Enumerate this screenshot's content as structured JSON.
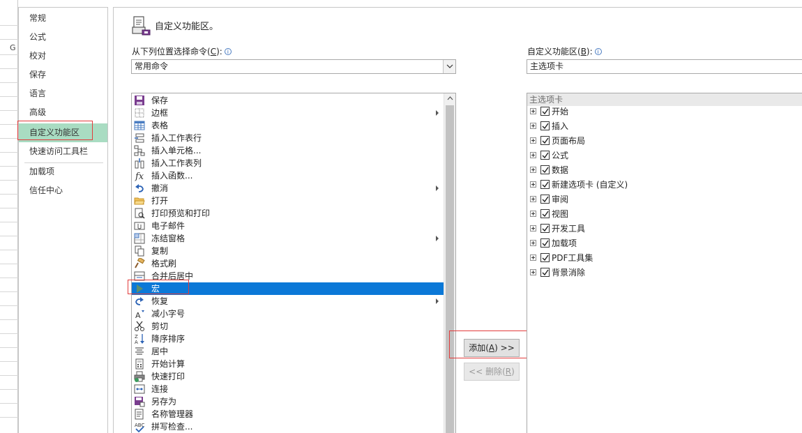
{
  "spreadsheet": {
    "column_letter": "G"
  },
  "nav": {
    "items": [
      {
        "label": "常规",
        "active": false
      },
      {
        "label": "公式",
        "active": false
      },
      {
        "label": "校对",
        "active": false
      },
      {
        "label": "保存",
        "active": false
      },
      {
        "label": "语言",
        "active": false
      },
      {
        "label": "高级",
        "active": false
      },
      {
        "label": "自定义功能区",
        "active": true
      },
      {
        "label": "快速访问工具栏",
        "active": false
      },
      {
        "label": "加载项",
        "active": false
      },
      {
        "label": "信任中心",
        "active": false
      }
    ]
  },
  "header": {
    "title": "自定义功能区。",
    "icon": "customize-ribbon-icon"
  },
  "left_panel": {
    "label": "从下列位置选择命令(C):",
    "label_text": "从下列位置选择命令(",
    "label_key": "C",
    "label_end": "):",
    "combo_value": "常用命令",
    "commands": [
      {
        "label": "保存",
        "icon": "save-icon",
        "submenu": false
      },
      {
        "label": "边框",
        "icon": "borders-icon",
        "submenu": true
      },
      {
        "label": "表格",
        "icon": "table-icon",
        "submenu": false
      },
      {
        "label": "插入工作表行",
        "icon": "insert-row-icon",
        "submenu": false
      },
      {
        "label": "插入单元格...",
        "icon": "insert-cells-icon",
        "submenu": false
      },
      {
        "label": "插入工作表列",
        "icon": "insert-column-icon",
        "submenu": false
      },
      {
        "label": "插入函数...",
        "icon": "function-icon",
        "submenu": false
      },
      {
        "label": "撤消",
        "icon": "undo-icon",
        "submenu": true
      },
      {
        "label": "打开",
        "icon": "open-folder-icon",
        "submenu": false
      },
      {
        "label": "打印预览和打印",
        "icon": "print-preview-icon",
        "submenu": false
      },
      {
        "label": "电子邮件",
        "icon": "email-attach-icon",
        "submenu": false
      },
      {
        "label": "冻结窗格",
        "icon": "freeze-panes-icon",
        "submenu": true
      },
      {
        "label": "复制",
        "icon": "copy-icon",
        "submenu": false
      },
      {
        "label": "格式刷",
        "icon": "format-painter-icon",
        "submenu": false
      },
      {
        "label": "合并后居中",
        "icon": "merge-center-icon",
        "submenu": false
      },
      {
        "label": "宏",
        "icon": "macro-play-icon",
        "submenu": false,
        "selected": true
      },
      {
        "label": "恢复",
        "icon": "redo-icon",
        "submenu": true
      },
      {
        "label": "减小字号",
        "icon": "decrease-font-icon",
        "submenu": false
      },
      {
        "label": "剪切",
        "icon": "scissors-icon",
        "submenu": false
      },
      {
        "label": "降序排序",
        "icon": "sort-descending-icon",
        "submenu": false
      },
      {
        "label": "居中",
        "icon": "align-center-icon",
        "submenu": false
      },
      {
        "label": "开始计算",
        "icon": "calculator-icon",
        "submenu": false
      },
      {
        "label": "快速打印",
        "icon": "quick-print-icon",
        "submenu": false
      },
      {
        "label": "连接",
        "icon": "connections-icon",
        "submenu": false
      },
      {
        "label": "另存为",
        "icon": "save-as-icon",
        "submenu": false
      },
      {
        "label": "名称管理器",
        "icon": "name-manager-icon",
        "submenu": false
      },
      {
        "label": "拼写检查...",
        "icon": "spell-check-icon",
        "submenu": false
      }
    ]
  },
  "buttons": {
    "add_text": "添加(",
    "add_key": "A",
    "add_end": ") >>",
    "remove_text": "<< 删除(",
    "remove_key": "R",
    "remove_end": ")"
  },
  "right_panel": {
    "label_text": "自定义功能区(",
    "label_key": "B",
    "label_end": "):",
    "combo_value": "主选项卡",
    "tree_header": "主选项卡",
    "tabs": [
      {
        "label": "开始",
        "checked": true
      },
      {
        "label": "插入",
        "checked": true
      },
      {
        "label": "页面布局",
        "checked": true
      },
      {
        "label": "公式",
        "checked": true
      },
      {
        "label": "数据",
        "checked": true
      },
      {
        "label": "新建选项卡 (自定义)",
        "checked": true
      },
      {
        "label": "审阅",
        "checked": true
      },
      {
        "label": "视图",
        "checked": true
      },
      {
        "label": "开发工具",
        "checked": true
      },
      {
        "label": "加载项",
        "checked": true
      },
      {
        "label": "PDF工具集",
        "checked": true
      },
      {
        "label": "背景消除",
        "checked": true
      }
    ]
  },
  "colors": {
    "nav_active": "#a9dcc2",
    "selection": "#0b78d7",
    "highlight_box": "#e23b3b"
  }
}
